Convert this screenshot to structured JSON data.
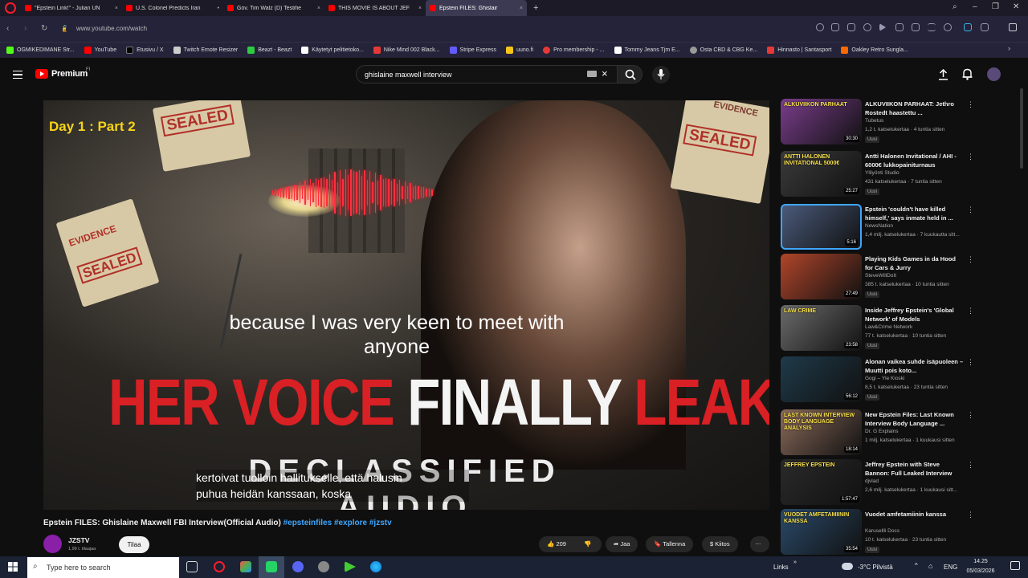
{
  "browser": {
    "tabs": [
      {
        "label": "\"Epstein Link!\" - Julian UN",
        "close": "×",
        "color": "#ff0000"
      },
      {
        "label": "U.S. Colonel Predicts Iran",
        "close": "•",
        "color": "#ff0000"
      },
      {
        "label": "Gov. Tim Walz (D) Testifie",
        "close": "×",
        "color": "#ff0000"
      },
      {
        "label": "THIS MOVIE IS ABOUT JEF",
        "close": "×",
        "color": "#ff0000"
      },
      {
        "label": "Epstein FILES: Ghislair",
        "close": "×",
        "color": "#ff0000"
      }
    ],
    "new_tab": "+",
    "url": "www.youtube.com/watch",
    "bookmarks": [
      {
        "label": "OGMIKEDIMANE Str...",
        "color": "#53fc18"
      },
      {
        "label": "YouTube",
        "color": "#ff0000"
      },
      {
        "label": "Etusivu / X",
        "color": "#000000"
      },
      {
        "label": "Twitch Emote Resizer",
        "color": "#cccccc"
      },
      {
        "label": "Beazt - Beazt",
        "color": "#2ecc40"
      },
      {
        "label": "Käytetyt pelitietoko...",
        "color": "#ffffff"
      },
      {
        "label": "Nike Mind 002 Black...",
        "color": "#e53935"
      },
      {
        "label": "Stripe Express",
        "color": "#635bff"
      },
      {
        "label": "uuno.fi",
        "color": "#f5c518"
      },
      {
        "label": "Pro membership - ...",
        "color": "#e53935"
      },
      {
        "label": "Tommy Jeans Tjm E...",
        "color": "#ffffff"
      },
      {
        "label": "Osta CBD & CBG Ke...",
        "color": "#999999"
      },
      {
        "label": "Hinnasto | Santasport",
        "color": "#e53935"
      },
      {
        "label": "Oakley Retro Sungla...",
        "color": "#ff6a00"
      }
    ]
  },
  "youtube": {
    "logo_text": "Premium",
    "logo_sup": "FI",
    "search_value": "ghislaine maxwell interview",
    "clear_symbol": "×"
  },
  "video": {
    "overlay_top": "Day 1 : Part 2",
    "paper_labels": [
      "SEALED",
      "EVIDENCE",
      "SEALED",
      "SEALED",
      "EVIDENCE"
    ],
    "caption_en_1": "because I was very keen to meet with",
    "caption_en_2": "anyone",
    "headline_red_1": "HER VOICE",
    "headline_white": "FINALLY",
    "headline_red_2": "LEAKED",
    "subheadline": "DECLASSIFIED AUDIO",
    "caption_fi_1": "kertoivat tuolloin hallitukselle, että halusin",
    "caption_fi_2": "puhua heidän kanssaan, koska",
    "title": "Epstein FILES: Ghislaine Maxwell FBI Interview(Official Audio)",
    "hashtags": "#epsteinfiles #explore #jzstv",
    "channel": "JZSTV",
    "subscribers": "1,99 t. tilaajaa",
    "subscribe_label": "Tilaa",
    "likes": "209",
    "share": "Jaa",
    "save": "Tallenna",
    "thanks": "Kiitos",
    "more": "…"
  },
  "recommendations": [
    {
      "title": "ALKUVIIKON PARHAAT: Jethro Rostedt haastettu ...",
      "channel": "Tubetus",
      "meta": "1,2 t. katselukertaa · 4 tuntia sitten",
      "badge": "Uusi",
      "duration": "30:30",
      "bg": "#7a3d8c"
    },
    {
      "title": "Antti Halonen Invitational / AHI - 6000€ lukkopainiturnaus",
      "channel": "Ylilyönti Studio",
      "meta": "431 katselukertaa · 7 tuntia sitten",
      "badge": "Uusi",
      "duration": "25:27",
      "bg": "#3b3b3b"
    },
    {
      "title": "Epstein 'couldn't have killed himself,' says inmate held in ...",
      "channel": "NewsNation",
      "meta": "1,4 milj. katselukertaa · 7 kuukautta sitt...",
      "badge": "",
      "duration": "5:16",
      "bg": "#4a5a7a"
    },
    {
      "title": "Playing Kids Games in da Hood for Cars & Jurry",
      "channel": "SteveWillDoIt",
      "meta": "385 t. katselukertaa · 10 tuntia sitten",
      "badge": "Uusi",
      "duration": "27:49",
      "bg": "#b0452a"
    },
    {
      "title": "Inside Jeffrey Epstein's 'Global Network' of Models",
      "channel": "Law&Crime Network",
      "meta": "77 t. katselukertaa · 10 tuntia sitten",
      "badge": "Uusi",
      "duration": "23:58",
      "bg": "#6b6b6b"
    },
    {
      "title": "Alonan vaikea suhde isäpuoleen – Muutti pois koto...",
      "channel": "Gogi – Yle Kioski",
      "meta": "8,5 t. katselukertaa · 23 tuntia sitten",
      "badge": "Uusi",
      "duration": "56:12",
      "bg": "#1f3a4a"
    },
    {
      "title": "New Epstein Files: Last Known Interview Body Language ...",
      "channel": "Dr. G Explains",
      "meta": "1 milj. katselukertaa · 1 kuukausi sitten",
      "badge": "",
      "duration": "18:14",
      "bg": "#8a6a5a"
    },
    {
      "title": "Jeffrey Epstein with Steve Bannon: Full Leaked Interview",
      "channel": "djvlad",
      "meta": "2,6 milj. katselukertaa · 1 kuukausi sitt...",
      "badge": "",
      "duration": "1:57:47",
      "bg": "#2a2a2a"
    },
    {
      "title": "Vuodet amfetamiinin kanssa",
      "channel": "Karusellli Docs",
      "meta": "10 t. katselukertaa · 23 tuntia sitten",
      "badge": "Uusi",
      "duration": "35:54",
      "bg": "#2a4a6a"
    }
  ],
  "rec_thumb_texts": [
    "ALKUVIIKON PARHAAT",
    "ANTTI HALONEN INVITATIONAL 5000€",
    "",
    "",
    "LAW CRIME",
    "",
    "LAST KNOWN INTERVIEW BODY LANGUAGE ANALYSIS",
    "JEFFREY EPSTEIN",
    "VUODET AMFETAMIININ KANSSA"
  ],
  "taskbar": {
    "search_placeholder": "Type here to search",
    "links": "Links",
    "weather": "-3°C Pilvistä",
    "lang": "ENG",
    "time": "14.25",
    "date": "05/03/2026"
  }
}
